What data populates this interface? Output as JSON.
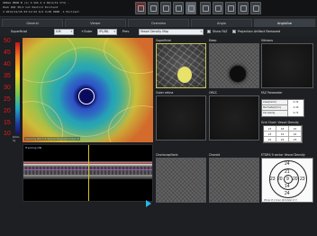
{
  "header": {
    "line1": "ORIGA PROB B (1) 4 SAS 4 4 04/2/14 Cfd) -",
    "line2": "Pack            RQI 30/1  Cut    Pentil1  Excllent",
    "line3": "4   2014/12/10 03:12:44    6/4  5/20  0000   -1   Excllent",
    "toolbar_icons": [
      "scan-icon",
      "compare-icon",
      "layers-icon",
      "grid-icon",
      "zoom-icon",
      "print-icon",
      "export-icon",
      "settings-icon",
      "report-icon",
      "help-icon"
    ]
  },
  "tabs": [
    {
      "label": "General",
      "active": false
    },
    {
      "label": "Viewer",
      "active": false
    },
    {
      "label": "Overview",
      "active": false
    },
    {
      "label": "Angio",
      "active": false
    },
    {
      "label": "AngioVue",
      "active": true
    }
  ],
  "controls": {
    "region_label": "Superficial",
    "slab_value": "ILM",
    "offset_label": "+Outer",
    "plexus_value": "IPL/INL",
    "type_label": "Prev",
    "map_value": "Vessel Density Map",
    "show_faz": "Show FAZ",
    "projection": "Projection Artifact Removed"
  },
  "left": {
    "scale_ticks": [
      "50",
      "45",
      "40",
      "35",
      "30",
      "25",
      "20",
      "15",
      "10"
    ],
    "scale_unit": "[mm-1]",
    "map_overlay": "Spacing (M) 3.4    Signal Strength Index 8",
    "bscan_label": "Tracking ON"
  },
  "panels": {
    "superficial": "Superficial",
    "deep": "Deep",
    "vitreous": "Vitreous",
    "outer_retina": "Outer retina",
    "orcc": "ORCC",
    "choriocapillaris": "Choriocapillaris",
    "choroid": "Choroid"
  },
  "faz": {
    "title": "FAZ Parameter",
    "rows": [
      {
        "label": "Area[mm2]",
        "value": "0.32"
      },
      {
        "label": "Perimeter[mm]",
        "value": "2.39"
      },
      {
        "label": "Circularity",
        "value": "0.72"
      }
    ]
  },
  "grid_chart": {
    "title": "Grid Chart: Vessel Density",
    "cells": [
      "23",
      "18",
      "22",
      "23",
      "15",
      "22",
      "22",
      "22",
      "23"
    ]
  },
  "etdrs": {
    "title": "ETDRS 9 sector Vessel Density",
    "center": "9",
    "inner": [
      "21",
      "20",
      "14",
      "20"
    ],
    "outer": [
      "24",
      "23",
      "24",
      "23"
    ],
    "footer": "Whole 17.2 Inner 16.6 Outer 17.7"
  }
}
